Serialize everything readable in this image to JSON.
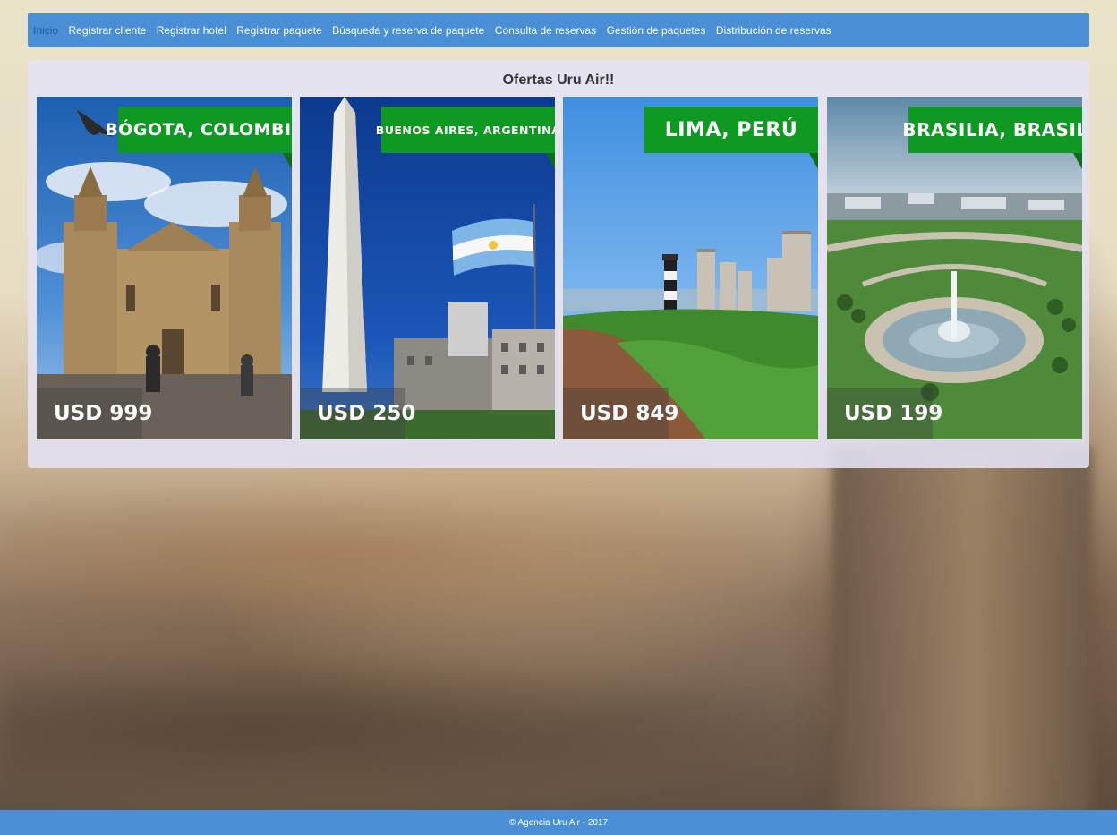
{
  "nav": {
    "items": [
      {
        "label": "Inicio",
        "active": true
      },
      {
        "label": "Registrar cliente"
      },
      {
        "label": "Registrar hotel"
      },
      {
        "label": "Registrar paquete"
      },
      {
        "label": "Búsqueda y reserva de paquete"
      },
      {
        "label": "Consulta de reservas"
      },
      {
        "label": "Gestión de paquetes"
      },
      {
        "label": "Distribución de reservas"
      }
    ]
  },
  "offers": {
    "title": "Ofertas Uru Air!!",
    "cards": [
      {
        "city": "BÓGOTA, COLOMBIA",
        "price": "USD 999"
      },
      {
        "city": "BUENOS AIRES, ARGENTINA",
        "price": "USD 250"
      },
      {
        "city": "LIMA, PERÚ",
        "price": "USD 849"
      },
      {
        "city": "BRASILIA, BRASIL",
        "price": "USD 199"
      }
    ]
  },
  "footer": {
    "text": "© Agencia Uru Air - 2017"
  },
  "colors": {
    "navbar": "#4a8fd6",
    "label_green": "#0e9a22",
    "panel": "#e4e2f5"
  }
}
